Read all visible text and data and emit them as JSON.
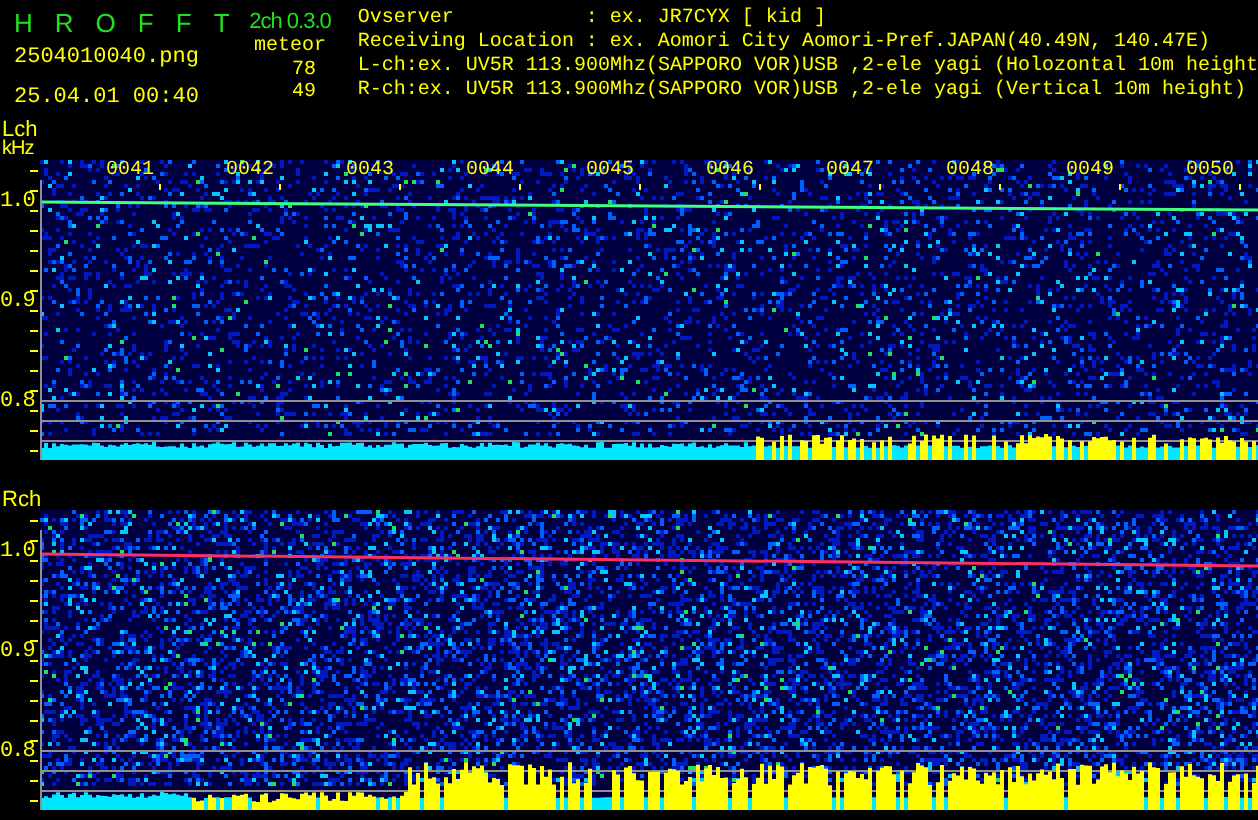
{
  "header": {
    "title_letters": [
      "H",
      "R",
      "O",
      "F",
      "F",
      "T"
    ],
    "version": "2ch 0.3.0",
    "filename": "2504010040.png",
    "datetime": "25.04.01 00:40",
    "meteor_label": "meteor",
    "meteor_counts": [
      "78",
      "49"
    ]
  },
  "info": [
    {
      "label": "Ovserver",
      "value": ": ex. JR7CYX [ kid ]"
    },
    {
      "label": "Receiving Location",
      "value": ": ex. Aomori City Aomori-Pref.JAPAN(40.49N, 140.47E)"
    }
  ],
  "channel_lines": [
    "L-ch:ex. UV5R 113.900Mhz(SAPPORO VOR)USB ,2-ele yagi (Holozontal 10m height",
    "R-ch:ex. UV5R 113.900Mhz(SAPPORO VOR)USB ,2-ele yagi (Vertical 10m height)"
  ],
  "time_labels": [
    "0041",
    "0042",
    "0043",
    "0044",
    "0045",
    "0046",
    "0047",
    "0048",
    "0049",
    "0050"
  ],
  "channels": [
    {
      "label": "Lch",
      "unit": "kHz",
      "color": "#40ff80",
      "yticks": [
        "1.0",
        "0.9",
        "0.8"
      ]
    },
    {
      "label": "Rch",
      "color": "#ff3060",
      "yticks": [
        "1.0",
        "0.9",
        "0.8"
      ]
    }
  ]
}
